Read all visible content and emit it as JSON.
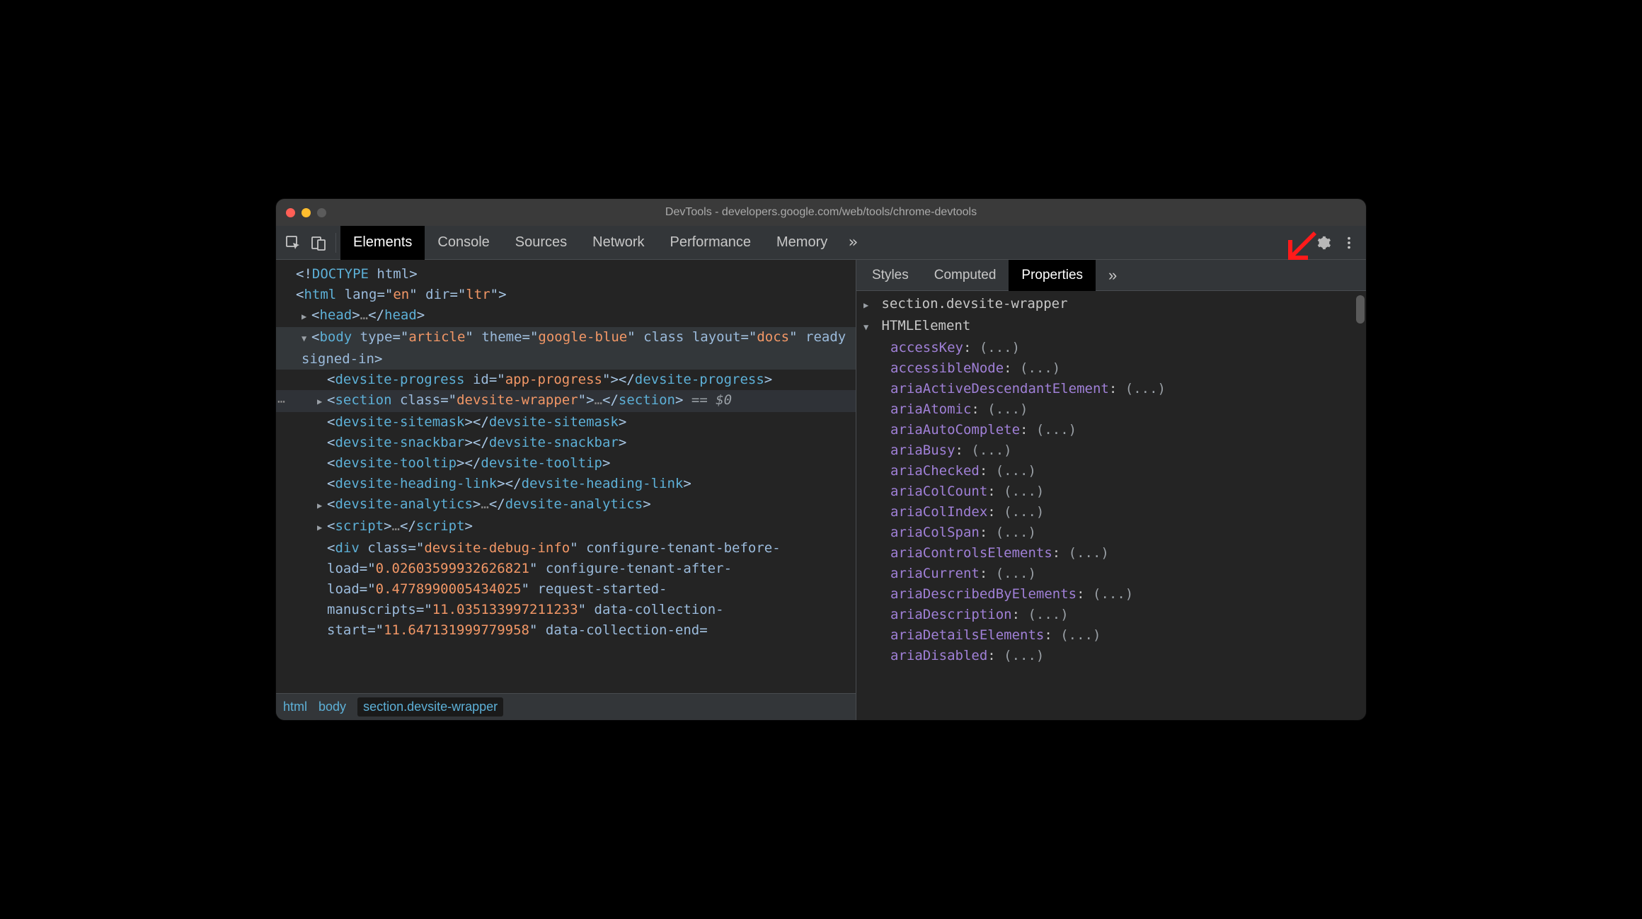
{
  "window": {
    "title": "DevTools - developers.google.com/web/tools/chrome-devtools"
  },
  "toolbar": {
    "tabs": [
      "Elements",
      "Console",
      "Sources",
      "Network",
      "Performance",
      "Memory"
    ],
    "active_tab": 0
  },
  "dom": {
    "lines": [
      {
        "indent": 0,
        "html": "<span class='punct'>&lt;!</span><span class='tag'>DOCTYPE</span> <span class='attr-name'>html</span><span class='punct'>&gt;</span>"
      },
      {
        "indent": 0,
        "html": "<span class='punct'>&lt;</span><span class='tag'>html</span> <span class='attr-name'>lang</span><span class='punct'>=&quot;</span><span class='attr-val'>en</span><span class='punct'>&quot;</span> <span class='attr-name'>dir</span><span class='punct'>=&quot;</span><span class='attr-val'>ltr</span><span class='punct'>&quot;&gt;</span>"
      },
      {
        "indent": 1,
        "tri": "▶",
        "html": "<span class='punct'>&lt;</span><span class='tag'>head</span><span class='punct'>&gt;</span><span class='dim'>…</span><span class='punct'>&lt;/</span><span class='tag'>head</span><span class='punct'>&gt;</span>"
      },
      {
        "indent": 1,
        "tri": "▼",
        "selected": true,
        "html": "<span class='punct'>&lt;</span><span class='tag'>body</span> <span class='attr-name'>type</span><span class='punct'>=&quot;</span><span class='attr-val'>article</span><span class='punct'>&quot;</span> <span class='attr-name'>theme</span><span class='punct'>=&quot;</span><span class='attr-val'>google-blue</span><span class='punct'>&quot;</span> <span class='attr-name'>class</span> <span class='attr-name'>layout</span><span class='punct'>=</span><span class='punct'>&quot;</span><span class='attr-val'>docs</span><span class='punct'>&quot;</span> <span class='attr-name'>ready</span> <span class='attr-name'>signed-in</span><span class='punct'>&gt;</span>"
      },
      {
        "indent": 2,
        "html": "<span class='punct'>&lt;</span><span class='tag'>devsite-progress</span> <span class='attr-name'>id</span><span class='punct'>=&quot;</span><span class='attr-val'>app-progress</span><span class='punct'>&quot;&gt;&lt;/</span><span class='tag'>devsite-progress</span><span class='punct'>&gt;</span>"
      },
      {
        "indent": 2,
        "tri": "▶",
        "dots": true,
        "html": "<span class='punct'>&lt;</span><span class='tag'>section</span> <span class='attr-name'>class</span><span class='punct'>=&quot;</span><span class='attr-val'>devsite-wrapper</span><span class='punct'>&quot;&gt;</span><span class='dim'>…</span><span class='punct'>&lt;/</span><span class='tag'>section</span><span class='punct'>&gt;</span> <span class='eq0'>== $0</span>",
        "highlight": true
      },
      {
        "indent": 2,
        "html": "<span class='punct'>&lt;</span><span class='tag'>devsite-sitemask</span><span class='punct'>&gt;&lt;/</span><span class='tag'>devsite-sitemask</span><span class='punct'>&gt;</span>"
      },
      {
        "indent": 2,
        "html": "<span class='punct'>&lt;</span><span class='tag'>devsite-snackbar</span><span class='punct'>&gt;&lt;/</span><span class='tag'>devsite-snackbar</span><span class='punct'>&gt;</span>"
      },
      {
        "indent": 2,
        "html": "<span class='punct'>&lt;</span><span class='tag'>devsite-tooltip</span><span class='punct'>&gt;&lt;/</span><span class='tag'>devsite-tooltip</span><span class='punct'>&gt;</span>"
      },
      {
        "indent": 2,
        "html": "<span class='punct'>&lt;</span><span class='tag'>devsite-heading-link</span><span class='punct'>&gt;&lt;/</span><span class='tag'>devsite-heading-link</span><span class='punct'>&gt;</span>"
      },
      {
        "indent": 2,
        "tri": "▶",
        "html": "<span class='punct'>&lt;</span><span class='tag'>devsite-analytics</span><span class='punct'>&gt;</span><span class='dim'>…</span><span class='punct'>&lt;/</span><span class='tag'>devsite-analytics</span><span class='punct'>&gt;</span>"
      },
      {
        "indent": 2,
        "tri": "▶",
        "html": "<span class='punct'>&lt;</span><span class='tag'>script</span><span class='punct'>&gt;</span><span class='dim'>…</span><span class='punct'>&lt;/</span><span class='tag'>script</span><span class='punct'>&gt;</span>"
      },
      {
        "indent": 2,
        "html": "<span class='punct'>&lt;</span><span class='tag'>div</span> <span class='attr-name'>class</span><span class='punct'>=&quot;</span><span class='attr-val'>devsite-debug-info</span><span class='punct'>&quot;</span> <span class='attr-name'>configure-tenant-before-load</span><span class='punct'>=&quot;</span><span class='attr-val'>0.02603599932626821</span><span class='punct'>&quot;</span> <span class='attr-name'>configure-tenant-after-load</span><span class='punct'>=&quot;</span><span class='attr-val'>0.4778990005434025</span><span class='punct'>&quot;</span> <span class='attr-name'>request-started-manuscripts</span><span class='punct'>=&quot;</span><span class='attr-val'>11.035133997211233</span><span class='punct'>&quot;</span> <span class='attr-name'>data-collection-start</span><span class='punct'>=&quot;</span><span class='attr-val'>11.647131999779958</span><span class='punct'>&quot;</span> <span class='attr-name'>data-collection-end</span><span class='punct'>=</span>"
      }
    ]
  },
  "breadcrumb": {
    "items": [
      "html",
      "body",
      "section.devsite-wrapper"
    ],
    "active": 2
  },
  "side": {
    "tabs": [
      "Styles",
      "Computed",
      "Properties"
    ],
    "active_tab": 2
  },
  "properties": {
    "section_header": "section.devsite-wrapper",
    "element_header": "HTMLElement",
    "props": [
      "accessKey",
      "accessibleNode",
      "ariaActiveDescendantElement",
      "ariaAtomic",
      "ariaAutoComplete",
      "ariaBusy",
      "ariaChecked",
      "ariaColCount",
      "ariaColIndex",
      "ariaColSpan",
      "ariaControlsElements",
      "ariaCurrent",
      "ariaDescribedByElements",
      "ariaDescription",
      "ariaDetailsElements",
      "ariaDisabled"
    ],
    "value_placeholder": "(...)"
  }
}
